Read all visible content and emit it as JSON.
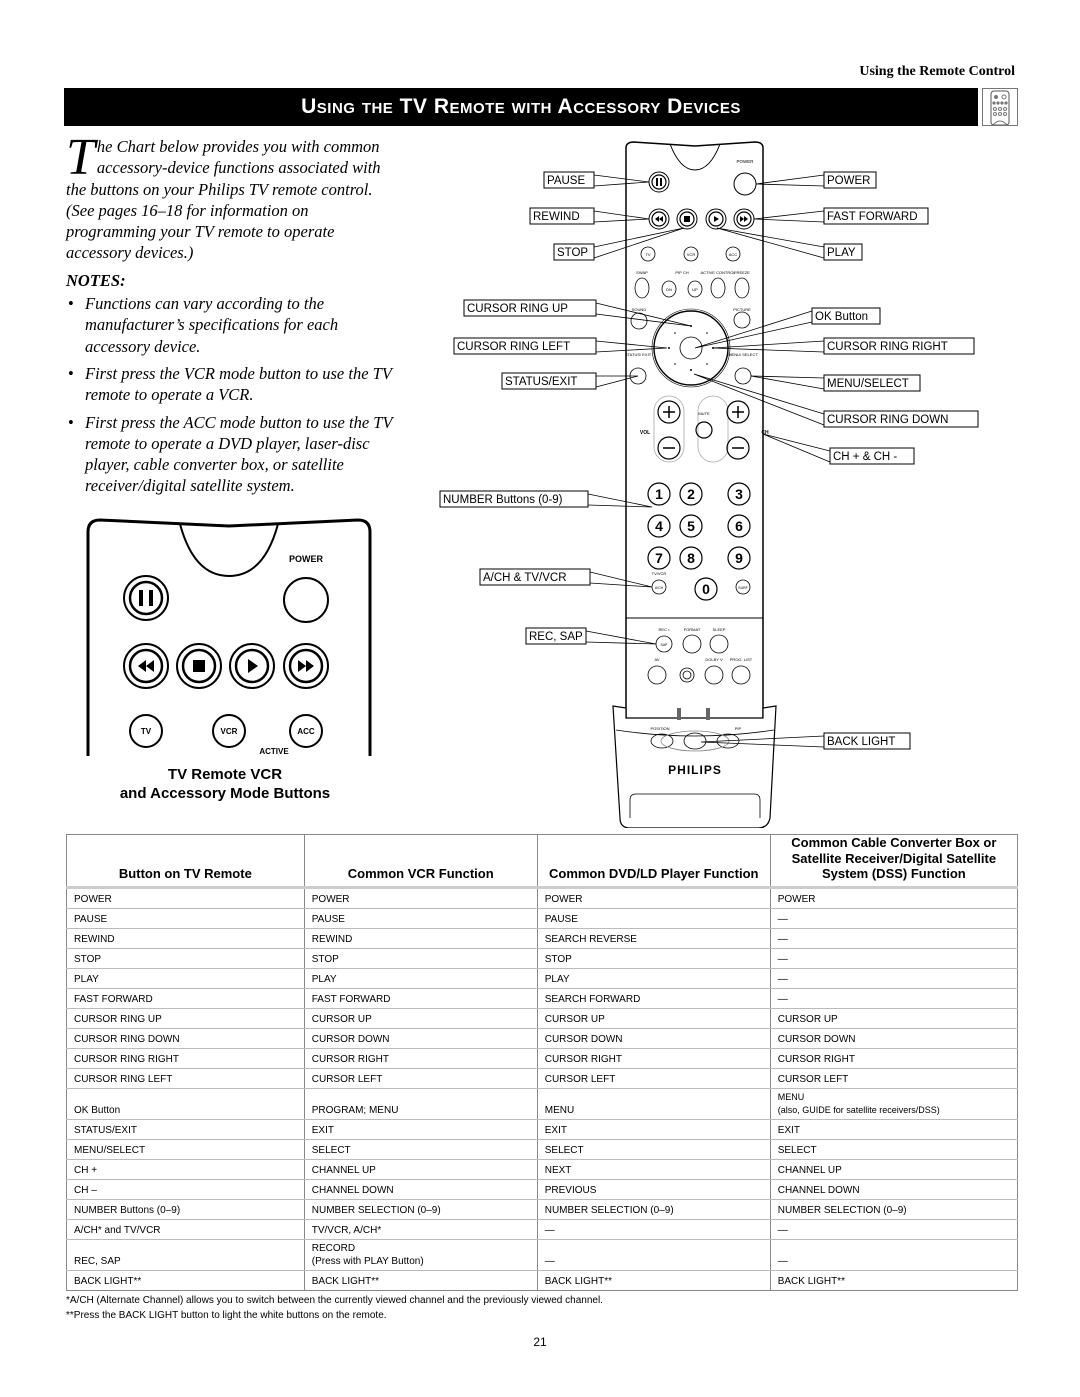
{
  "header": {
    "section_label": "Using the Remote Control",
    "banner_title": "Using the TV Remote with Accessory Devices",
    "banner_icon": "remote-control-icon"
  },
  "intro": {
    "dropcap": "T",
    "paragraph": "he Chart below provides you with common accessory-device functions associated with the buttons on your Philips TV remote control. (See pages 16–18 for information on programming your TV remote to operate accessory devices.)",
    "notes_heading": "NOTES:",
    "notes": [
      "Functions can vary according to the manufacturer’s specifications for each accessory device.",
      "First press the VCR mode button to use the TV remote to operate a VCR.",
      "First press the ACC mode button to use the TV remote to operate a DVD player, laser-disc player, cable converter box, or satellite receiver/digital satellite system."
    ]
  },
  "small_remote": {
    "power_label": "POWER",
    "mode_buttons": [
      "TV",
      "VCR",
      "ACC"
    ],
    "active_label": "ACTIVE",
    "caption_line1": "TV Remote VCR",
    "caption_line2": "and Accessory Mode Buttons"
  },
  "big_remote": {
    "callouts_left": [
      "PAUSE",
      "REWIND",
      "STOP",
      "CURSOR RING UP",
      "CURSOR RING LEFT",
      "STATUS/EXIT",
      "NUMBER Buttons (0-9)",
      "A/CH & TV/VCR",
      "REC, SAP"
    ],
    "callouts_right": [
      "POWER",
      "FAST FORWARD",
      "PLAY",
      "OK Button",
      "CURSOR RING RIGHT",
      "MENU/SELECT",
      "CURSOR RING DOWN",
      "CH + & CH -",
      "BACK LIGHT"
    ],
    "key_labels": {
      "power": "POWER",
      "tv": "TV",
      "vcr": "VCR",
      "acc": "ACC",
      "swap": "SWAP",
      "pip_ch": "PIP CH",
      "dn": "DN",
      "up": "UP",
      "active_control": "ACTIVE CONTROL",
      "freeze": "FREEZE",
      "sound": "SOUND",
      "picture": "PICTURE",
      "status_exit": "STATUS/ EXIT",
      "menu_select": "MENU/ SELECT",
      "mute": "MUTE",
      "vol": "VOL",
      "ch": "CH",
      "tvvcr": "TV/VCR",
      "ach": "A/CH",
      "surf": "SURF",
      "rec": "REC •",
      "sap": "SAP",
      "format": "FORMAT",
      "sleep": "SLEEP",
      "av": "AV",
      "dolby": "DOLBY V",
      "prog_list": "PROG. LIST",
      "position": "POSITION",
      "pip": "PIP",
      "brand": "PHILIPS"
    },
    "digits": [
      "1",
      "2",
      "3",
      "4",
      "5",
      "6",
      "7",
      "8",
      "9",
      "0"
    ]
  },
  "chart": {
    "headers": [
      "Button on TV Remote",
      "Common VCR Function",
      "Common DVD/LD Player Function",
      "Common Cable Converter Box or Satellite Receiver/Digital Satellite System (DSS) Function"
    ],
    "rows": [
      [
        "POWER",
        "POWER",
        "POWER",
        "POWER"
      ],
      [
        "PAUSE",
        "PAUSE",
        "PAUSE",
        "—"
      ],
      [
        "REWIND",
        "REWIND",
        "SEARCH REVERSE",
        "—"
      ],
      [
        "STOP",
        "STOP",
        "STOP",
        "—"
      ],
      [
        "PLAY",
        "PLAY",
        "PLAY",
        "—"
      ],
      [
        "FAST FORWARD",
        "FAST FORWARD",
        "SEARCH FORWARD",
        "—"
      ],
      [
        "CURSOR RING UP",
        "CURSOR UP",
        "CURSOR UP",
        "CURSOR UP"
      ],
      [
        "CURSOR RING DOWN",
        "CURSOR DOWN",
        "CURSOR DOWN",
        "CURSOR DOWN"
      ],
      [
        "CURSOR RING RIGHT",
        "CURSOR RIGHT",
        "CURSOR RIGHT",
        "CURSOR RIGHT"
      ],
      [
        "CURSOR RING LEFT",
        "CURSOR LEFT",
        "CURSOR LEFT",
        "CURSOR LEFT"
      ],
      [
        "OK Button",
        "PROGRAM; MENU",
        "MENU",
        "MENU\n(also, GUIDE for satellite receivers/DSS)"
      ],
      [
        "STATUS/EXIT",
        "EXIT",
        "EXIT",
        "EXIT"
      ],
      [
        "MENU/SELECT",
        "SELECT",
        "SELECT",
        "SELECT"
      ],
      [
        "CH +",
        "CHANNEL UP",
        "NEXT",
        "CHANNEL UP"
      ],
      [
        "CH –",
        "CHANNEL DOWN",
        "PREVIOUS",
        "CHANNEL DOWN"
      ],
      [
        "NUMBER Buttons (0–9)",
        "NUMBER SELECTION (0–9)",
        "NUMBER SELECTION (0–9)",
        "NUMBER SELECTION (0–9)"
      ],
      [
        "A/CH* and TV/VCR",
        "TV/VCR, A/CH*",
        "—",
        "—"
      ],
      [
        "REC, SAP",
        "RECORD\n(Press with PLAY Button)",
        "—",
        "—"
      ],
      [
        "BACK LIGHT**",
        "BACK LIGHT**",
        "BACK LIGHT**",
        "BACK LIGHT**"
      ]
    ]
  },
  "footnotes": [
    "*A/CH (Alternate Channel) allows you to switch between the currently viewed channel and the previously viewed channel.",
    "**Press the BACK LIGHT button to light the white buttons on the remote."
  ],
  "page_number": "21"
}
